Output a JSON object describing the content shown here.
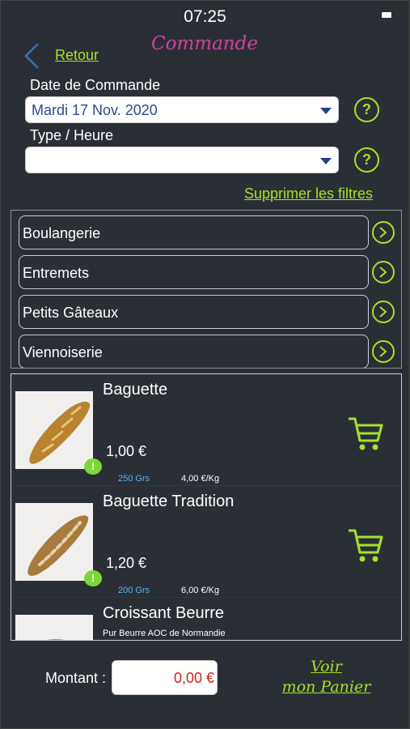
{
  "status": {
    "time": "07:25"
  },
  "header": {
    "back_label": "Retour",
    "title": "Commande"
  },
  "filters": {
    "date_label": "Date de Commande",
    "date_value": "Mardi 17 Nov. 2020",
    "type_label": "Type / Heure",
    "type_value": "",
    "help_glyph": "?",
    "clear_label": "Supprimer les filtres"
  },
  "categories": [
    {
      "label": "Boulangerie"
    },
    {
      "label": "Entremets"
    },
    {
      "label": "Petits Gâteaux"
    },
    {
      "label": "Viennoiserie"
    }
  ],
  "products": [
    {
      "name": "Baguette",
      "subtitle": "",
      "price": "1,00 €",
      "weight": "250 Grs",
      "price_per_kg": "4,00 €/Kg",
      "image": "baguette"
    },
    {
      "name": "Baguette Tradition",
      "subtitle": "",
      "price": "1,20 €",
      "weight": "200 Grs",
      "price_per_kg": "6,00 €/Kg",
      "image": "baguette-tradition"
    },
    {
      "name": "Croissant Beurre",
      "subtitle": "Pur Beurre AOC de Normandie",
      "price": "",
      "weight": "",
      "price_per_kg": "",
      "image": "croissant"
    }
  ],
  "footer": {
    "amount_label": "Montant :",
    "amount_value": "0,00 €",
    "cart_link_line1": "Voir",
    "cart_link_line2": "mon Panier"
  },
  "colors": {
    "background": "#2a2f35",
    "accent": "#a8e02a",
    "title": "#d23fa0",
    "weight_text": "#58b6e6",
    "amount_text": "#cc2222"
  },
  "icons": {
    "back": "chevron-left-icon",
    "help": "question-circle-icon",
    "category_go": "chevron-right-circle-icon",
    "cart": "shopping-cart-icon",
    "comment": "comment-bubble-icon",
    "dropdown": "caret-down-icon"
  }
}
